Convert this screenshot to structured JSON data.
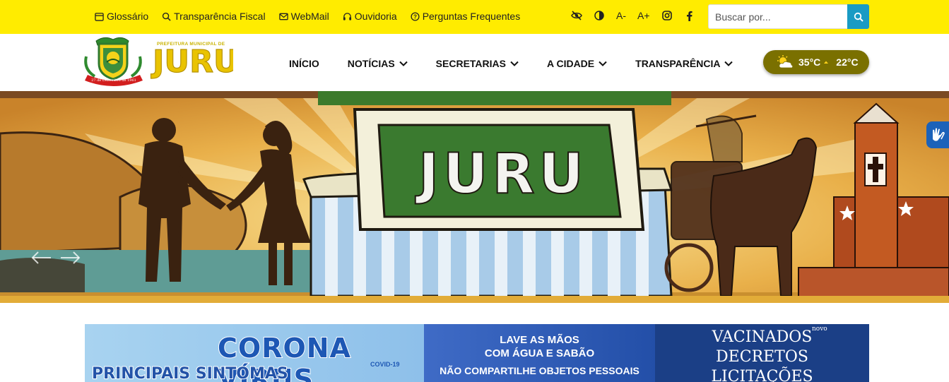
{
  "topbar": {
    "links": [
      {
        "label": "Glossário",
        "icon": "calendar-icon"
      },
      {
        "label": "Transparência Fiscal",
        "icon": "search-icon"
      },
      {
        "label": "WebMail",
        "icon": "envelope-icon"
      },
      {
        "label": "Ouvidoria",
        "icon": "headset-icon"
      },
      {
        "label": "Perguntas Frequentes",
        "icon": "question-circle-icon"
      }
    ],
    "accessibility": {
      "font_decrease": "A-",
      "font_increase": "A+",
      "icons": [
        "eye-slash-icon",
        "contrast-icon",
        "instagram-icon",
        "facebook-icon"
      ]
    },
    "search": {
      "placeholder": "Buscar por..."
    }
  },
  "header": {
    "logo": {
      "line1": "PREFEITURA MUNICIPAL DE",
      "name": "JURU",
      "ribbon": "27 de Dezembro de 1961"
    },
    "nav": [
      {
        "label": "INÍCIO",
        "has_dropdown": false
      },
      {
        "label": "NOTÍCIAS",
        "has_dropdown": true
      },
      {
        "label": "SECRETARIAS",
        "has_dropdown": true
      },
      {
        "label": "A CIDADE",
        "has_dropdown": true
      },
      {
        "label": "TRANSPARÊNCIA",
        "has_dropdown": true
      }
    ],
    "weather": {
      "max": "35°C",
      "min": "22°C",
      "icon": "partly-sunny-icon"
    }
  },
  "hero": {
    "sign_text": "JURU",
    "controls": {
      "prev": "arrow-left-icon",
      "next": "arrow-right-icon"
    }
  },
  "banner": {
    "title": "CORONA VÍRUS",
    "subtitle": "COVID-19",
    "symptoms": "PRINCIPAIS SINTOMAS",
    "mid_line1": "LAVE AS MÃOS",
    "mid_line2": "COM ÁGUA E SABÃO",
    "mid_line3": "NÃO COMPARTILHE OBJETOS PESSOAIS",
    "right_new": "novo",
    "right_items": [
      "VACINADOS",
      "DECRETOS",
      "LICITAÇÕES"
    ]
  },
  "colors": {
    "topbar": "#ffec00",
    "search_button": "#1a9bc4",
    "weather_pill": "#7a7000",
    "vlibras": "#1c62b9"
  }
}
